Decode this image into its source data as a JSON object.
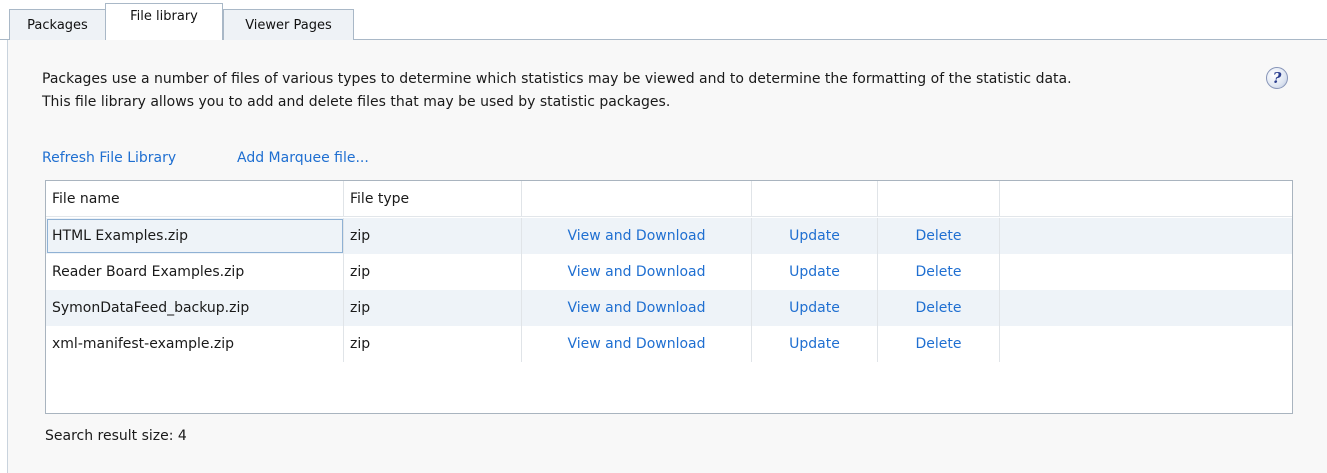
{
  "tabs": [
    {
      "label": "Packages",
      "active": false
    },
    {
      "label": "File library",
      "active": true
    },
    {
      "label": "Viewer Pages",
      "active": false
    }
  ],
  "description": {
    "line1": "Packages use a number of files of various types to determine which statistics may be viewed and to determine the formatting of the statistic data.",
    "line2": "This file library allows you to add and delete files that may be used by statistic packages."
  },
  "help_icon": {
    "glyph": "?",
    "icon": "help-icon"
  },
  "actions": {
    "refresh_label": "Refresh File Library",
    "add_label": "Add Marquee file..."
  },
  "table": {
    "columns": [
      "File name",
      "File type",
      "",
      "",
      "",
      ""
    ],
    "rows": [
      {
        "name": "HTML Examples.zip",
        "type": "zip",
        "view": "View and Download",
        "update": "Update",
        "delete": "Delete"
      },
      {
        "name": "Reader Board Examples.zip",
        "type": "zip",
        "view": "View and Download",
        "update": "Update",
        "delete": "Delete"
      },
      {
        "name": "SymonDataFeed_backup.zip",
        "type": "zip",
        "view": "View and Download",
        "update": "Update",
        "delete": "Delete"
      },
      {
        "name": "xml-manifest-example.zip",
        "type": "zip",
        "view": "View and Download",
        "update": "Update",
        "delete": "Delete"
      }
    ]
  },
  "status": {
    "text": "Search result size: 4"
  },
  "colors": {
    "link": "#1f6fd1",
    "alt_row": "#eef3f8",
    "panel": "#f8f8f8"
  }
}
